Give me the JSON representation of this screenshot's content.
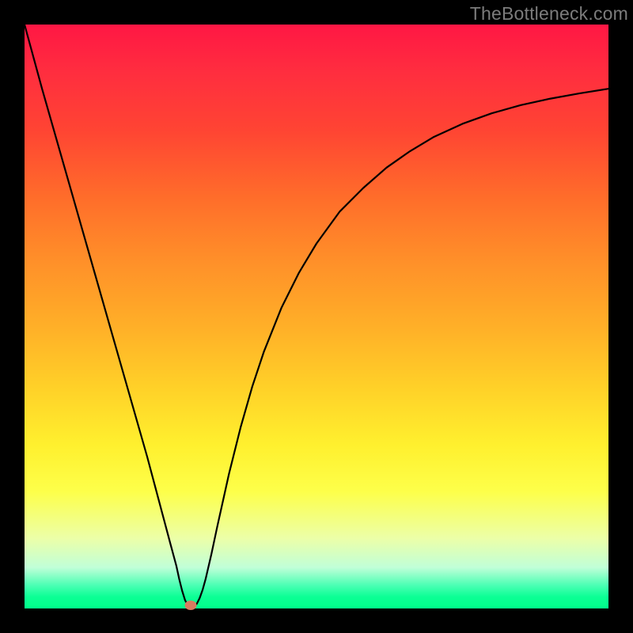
{
  "attribution": "TheBottleneck.com",
  "chart_data": {
    "type": "line",
    "title": "",
    "xlabel": "",
    "ylabel": "",
    "xlim": [
      0,
      100
    ],
    "ylim": [
      0,
      100
    ],
    "marker": {
      "x": 28.5,
      "y": 0.5
    },
    "series": [
      {
        "name": "curve",
        "points": [
          {
            "x": 0.0,
            "y": 100.0
          },
          {
            "x": 3.0,
            "y": 89.0
          },
          {
            "x": 6.0,
            "y": 78.5
          },
          {
            "x": 9.0,
            "y": 68.0
          },
          {
            "x": 12.0,
            "y": 57.5
          },
          {
            "x": 15.0,
            "y": 47.0
          },
          {
            "x": 18.0,
            "y": 36.5
          },
          {
            "x": 21.0,
            "y": 26.0
          },
          {
            "x": 23.0,
            "y": 18.5
          },
          {
            "x": 25.0,
            "y": 11.0
          },
          {
            "x": 26.0,
            "y": 7.3
          },
          {
            "x": 26.5,
            "y": 5.0
          },
          {
            "x": 27.0,
            "y": 3.0
          },
          {
            "x": 27.5,
            "y": 1.4
          },
          {
            "x": 28.0,
            "y": 0.5
          },
          {
            "x": 28.5,
            "y": 0.2
          },
          {
            "x": 29.0,
            "y": 0.3
          },
          {
            "x": 29.5,
            "y": 0.8
          },
          {
            "x": 30.0,
            "y": 1.8
          },
          {
            "x": 30.5,
            "y": 3.2
          },
          {
            "x": 31.0,
            "y": 5.0
          },
          {
            "x": 32.0,
            "y": 9.3
          },
          {
            "x": 33.0,
            "y": 14.0
          },
          {
            "x": 34.0,
            "y": 18.5
          },
          {
            "x": 35.0,
            "y": 23.0
          },
          {
            "x": 37.0,
            "y": 31.0
          },
          {
            "x": 39.0,
            "y": 38.0
          },
          {
            "x": 41.0,
            "y": 44.0
          },
          {
            "x": 44.0,
            "y": 51.5
          },
          {
            "x": 47.0,
            "y": 57.5
          },
          {
            "x": 50.0,
            "y": 62.5
          },
          {
            "x": 54.0,
            "y": 68.0
          },
          {
            "x": 58.0,
            "y": 72.0
          },
          {
            "x": 62.0,
            "y": 75.5
          },
          {
            "x": 66.0,
            "y": 78.3
          },
          {
            "x": 70.0,
            "y": 80.7
          },
          {
            "x": 75.0,
            "y": 83.0
          },
          {
            "x": 80.0,
            "y": 84.8
          },
          {
            "x": 85.0,
            "y": 86.2
          },
          {
            "x": 90.0,
            "y": 87.3
          },
          {
            "x": 95.0,
            "y": 88.2
          },
          {
            "x": 100.0,
            "y": 89.0
          }
        ]
      }
    ],
    "background_gradient": {
      "top": "#ff1744",
      "middle": "#ffd028",
      "bottom": "#00ff8a"
    }
  }
}
